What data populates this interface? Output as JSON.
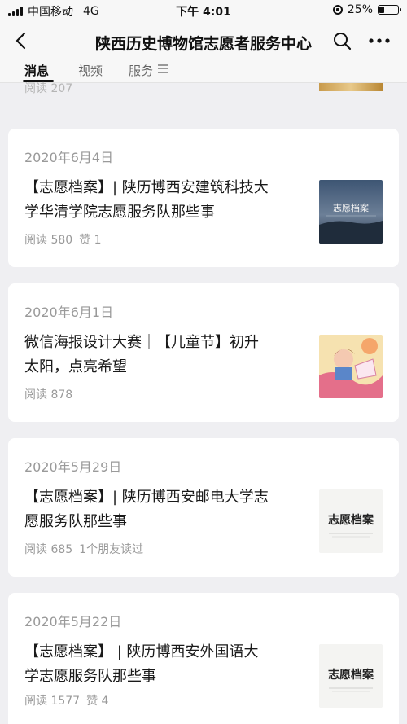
{
  "status_bar": {
    "carrier": "中国移动",
    "network": "4G",
    "time": "下午 4:01",
    "battery_pct": "25%",
    "battery_level": 0.25
  },
  "nav": {
    "title": "陕西历史博物馆志愿者服务中心",
    "back_icon": "chevron-left-icon",
    "search_icon": "search-icon",
    "more_icon": "more-dots-icon"
  },
  "tabs": [
    {
      "label": "消息",
      "active": true
    },
    {
      "label": "视频",
      "active": false
    },
    {
      "label": "服务",
      "active": false
    }
  ],
  "partial_item": {
    "meta": "阅读 207"
  },
  "articles": [
    {
      "date": "2020年6月4日",
      "title_line1": "【志愿档案】| 陕历博西安建筑科技大",
      "title_line2": "学华清学院志愿服务队那些事",
      "reads": "阅读 580",
      "extra": "赞 1",
      "thumb_text": "志愿档案"
    },
    {
      "date": "2020年6月1日",
      "title_line1": "微信海报设计大赛｜【儿童节】初升",
      "title_line2": "太阳，点亮希望",
      "reads": "阅读 878",
      "extra": "",
      "thumb_text": ""
    },
    {
      "date": "2020年5月29日",
      "title_line1": "【志愿档案】| 陕历博西安邮电大学志",
      "title_line2": "愿服务队那些事",
      "reads": "阅读 685",
      "extra": "1个朋友读过",
      "thumb_text": "志愿档案"
    },
    {
      "date": "2020年5月22日",
      "title_line1": "【志愿档案】 | 陕历博西安外国语大",
      "title_line2": "学志愿服务队那些事",
      "reads": "阅读 1577",
      "extra": "赞 4",
      "thumb_text": "志愿档案"
    }
  ]
}
